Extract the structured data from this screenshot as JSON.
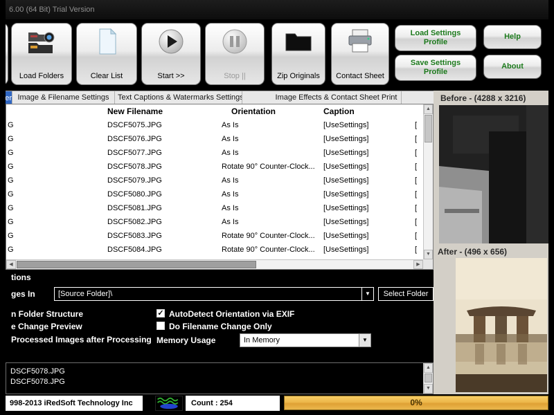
{
  "title_bar": {
    "title": "6.00 (64 Bit) Trial Version"
  },
  "toolbar": {
    "load_folders": "Load Folders",
    "clear_list": "Clear List",
    "start": "Start >>",
    "stop": "Stop ||",
    "zip_originals": "Zip Originals",
    "contact_sheet": "Contact Sheet",
    "load_settings_profile": "Load Settings Profile",
    "save_settings_profile": "Save Settings Profile",
    "help": "Help",
    "about": "About"
  },
  "tabs": {
    "clipped_tab": "er",
    "image_filename": "Image & Filename Settings",
    "text_captions": "Text Captions & Watermarks Settings",
    "image_effects": "Image Effects & Contact Sheet Print"
  },
  "table": {
    "headers": {
      "new_filename": "New Filename",
      "orientation": "Orientation",
      "caption": "Caption"
    },
    "rows": [
      {
        "orig": "G",
        "new_filename": "DSCF5075.JPG",
        "orientation": "As Is",
        "caption": "[UseSettings]",
        "clipped": "["
      },
      {
        "orig": "G",
        "new_filename": "DSCF5076.JPG",
        "orientation": "As Is",
        "caption": "[UseSettings]",
        "clipped": "["
      },
      {
        "orig": "G",
        "new_filename": "DSCF5077.JPG",
        "orientation": "As Is",
        "caption": "[UseSettings]",
        "clipped": "["
      },
      {
        "orig": "G",
        "new_filename": "DSCF5078.JPG",
        "orientation": "Rotate 90° Counter-Clock...",
        "caption": "[UseSettings]",
        "clipped": "["
      },
      {
        "orig": "G",
        "new_filename": "DSCF5079.JPG",
        "orientation": "As Is",
        "caption": "[UseSettings]",
        "clipped": "["
      },
      {
        "orig": "G",
        "new_filename": "DSCF5080.JPG",
        "orientation": "As Is",
        "caption": "[UseSettings]",
        "clipped": "["
      },
      {
        "orig": "G",
        "new_filename": "DSCF5081.JPG",
        "orientation": "As Is",
        "caption": "[UseSettings]",
        "clipped": "["
      },
      {
        "orig": "G",
        "new_filename": "DSCF5082.JPG",
        "orientation": "As Is",
        "caption": "[UseSettings]",
        "clipped": "["
      },
      {
        "orig": "G",
        "new_filename": "DSCF5083.JPG",
        "orientation": "Rotate 90° Counter-Clock...",
        "caption": "[UseSettings]",
        "clipped": "["
      },
      {
        "orig": "G",
        "new_filename": "DSCF5084.JPG",
        "orientation": "Rotate 90° Counter-Clock...",
        "caption": "[UseSettings]",
        "clipped": "["
      }
    ]
  },
  "preview": {
    "before_label": "Before - (4288 x 3216)",
    "after_label": "After - (496 x 656)"
  },
  "options": {
    "header": "tions",
    "save_images_in_label": "ges In",
    "folder_combo_value": "[Source Folder]\\",
    "select_folder_button": "Select Folder",
    "retain_folder_structure": "n Folder Structure",
    "filename_change_preview": "e Change Preview",
    "processed_images": "Processed Images after Processing",
    "autodetect_exif": "AutoDetect Orientation via EXIF",
    "do_filename_change_only": "Do Filename Change Only",
    "memory_usage_label": "Memory Usage",
    "memory_usage_value": "In Memory"
  },
  "log": {
    "lines": [
      "DSCF5078.JPG",
      "DSCF5078.JPG"
    ]
  },
  "status_bar": {
    "copyright": "998-2013 iRedSoft Technology Inc",
    "count": "Count : 254",
    "progress": "0%"
  },
  "icons": {
    "load_folders": "folders-camera-icon",
    "clear_list": "document-icon",
    "start": "play-icon",
    "stop": "pause-icon",
    "zip_originals": "black-folder-icon",
    "contact_sheet": "printer-icon",
    "dropdown": "▼",
    "check": "✓",
    "logo": "iredsoft-logo"
  },
  "colors": {
    "tab_selected_blue": "#2f66c2",
    "profile_button_green": "#1c7a1c",
    "progress_gold": "#edb74a",
    "panel_gray": "#d3cfc7"
  }
}
